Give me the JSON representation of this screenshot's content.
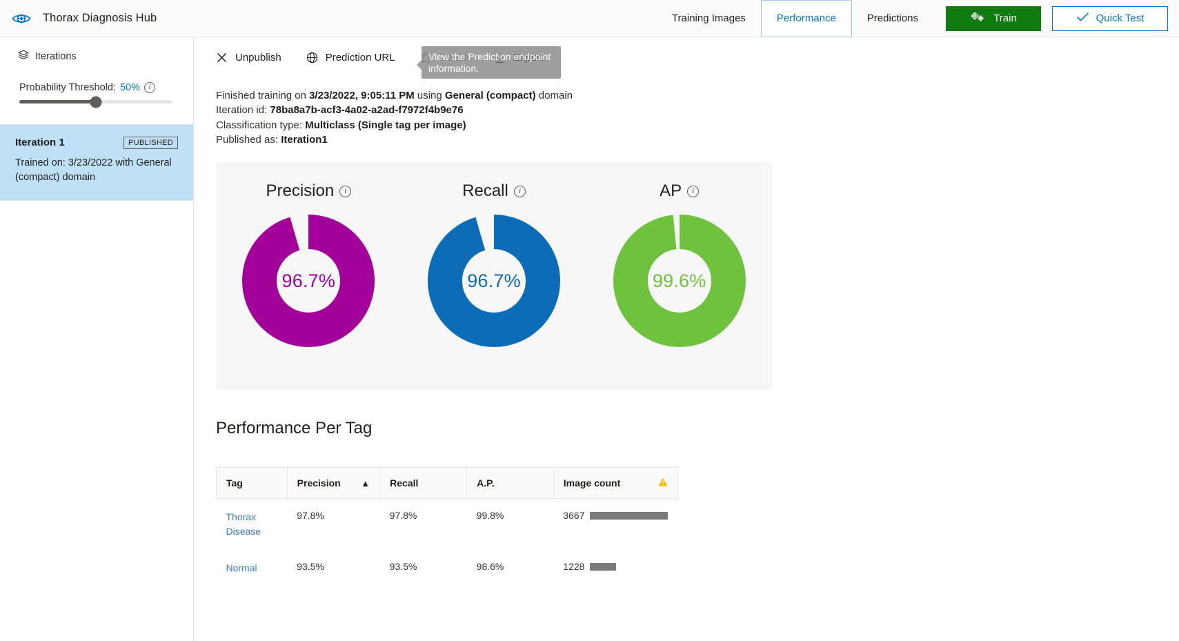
{
  "app": {
    "logo_icon": "eye-gear-icon",
    "title": "Thorax Diagnosis Hub"
  },
  "topnav": {
    "tabs": [
      {
        "label": "Training Images",
        "active": false
      },
      {
        "label": "Performance",
        "active": true
      },
      {
        "label": "Predictions",
        "active": false
      }
    ],
    "train_button": {
      "label": "Train",
      "icon": "gears-icon",
      "color": "#107c10"
    },
    "quick_test_button": {
      "label": "Quick Test",
      "icon": "check-icon",
      "color": "#0078d4"
    }
  },
  "sidebar": {
    "heading": "Iterations",
    "heading_icon": "layers-icon",
    "threshold": {
      "label": "Probability Threshold:",
      "value": "50%",
      "percent": 50,
      "info_icon": "info-icon"
    },
    "iterations": [
      {
        "name": "Iteration 1",
        "badge": "PUBLISHED",
        "subtitle": "Trained on: 3/23/2022 with General (compact) domain",
        "selected": true
      }
    ]
  },
  "commandbar": {
    "items": [
      {
        "label": "Unpublish",
        "icon": "close-x-icon",
        "disabled": false
      },
      {
        "label": "Prediction URL",
        "icon": "globe-icon",
        "disabled": false
      },
      {
        "label": "Delete",
        "icon": "trash-icon",
        "disabled": true
      },
      {
        "label": "Export",
        "icon": "download-icon",
        "disabled": false
      }
    ],
    "tooltip": "View the Prediction endpoint information."
  },
  "meta": {
    "line1_prefix": "Finished training on ",
    "finished_on": "3/23/2022, 9:05:11 PM",
    "line1_mid": " using ",
    "domain": "General (compact)",
    "line1_suffix": " domain",
    "line2_label": "Iteration id: ",
    "iteration_id": "78ba8a7b-acf3-4a02-a2ad-f7972f4b9e76",
    "line3_label": "Classification type: ",
    "classification_type": "Multiclass (Single tag per image)",
    "line4_label": "Published as: ",
    "published_as": "Iteration1"
  },
  "chart_data": [
    {
      "type": "pie",
      "title": "Precision",
      "value": 96.7,
      "display": "96.7%",
      "color": "#a4009a",
      "track": "#f7f7f7",
      "ylim": [
        0,
        100
      ]
    },
    {
      "type": "pie",
      "title": "Recall",
      "value": 96.7,
      "display": "96.7%",
      "color": "#0c6cb8",
      "track": "#f7f7f7",
      "ylim": [
        0,
        100
      ]
    },
    {
      "type": "pie",
      "title": "AP",
      "value": 99.6,
      "display": "99.6%",
      "color": "#6ec23d",
      "track": "#f7f7f7",
      "ylim": [
        0,
        100
      ]
    }
  ],
  "pertag": {
    "title": "Performance Per Tag",
    "columns": [
      {
        "label": "Tag",
        "sort": null,
        "warn": false
      },
      {
        "label": "Precision",
        "sort": "asc",
        "warn": false
      },
      {
        "label": "Recall",
        "sort": null,
        "warn": false
      },
      {
        "label": "A.P.",
        "sort": null,
        "warn": false
      },
      {
        "label": "Image count",
        "sort": null,
        "warn": true
      }
    ],
    "rows": [
      {
        "tag": "Thorax Disease",
        "precision": "97.8%",
        "recall": "97.8%",
        "ap": "99.8%",
        "image_count": "3667",
        "bar_pct": 100
      },
      {
        "tag": "Normal",
        "precision": "93.5%",
        "recall": "93.5%",
        "ap": "98.6%",
        "image_count": "1228",
        "bar_pct": 33
      }
    ]
  }
}
